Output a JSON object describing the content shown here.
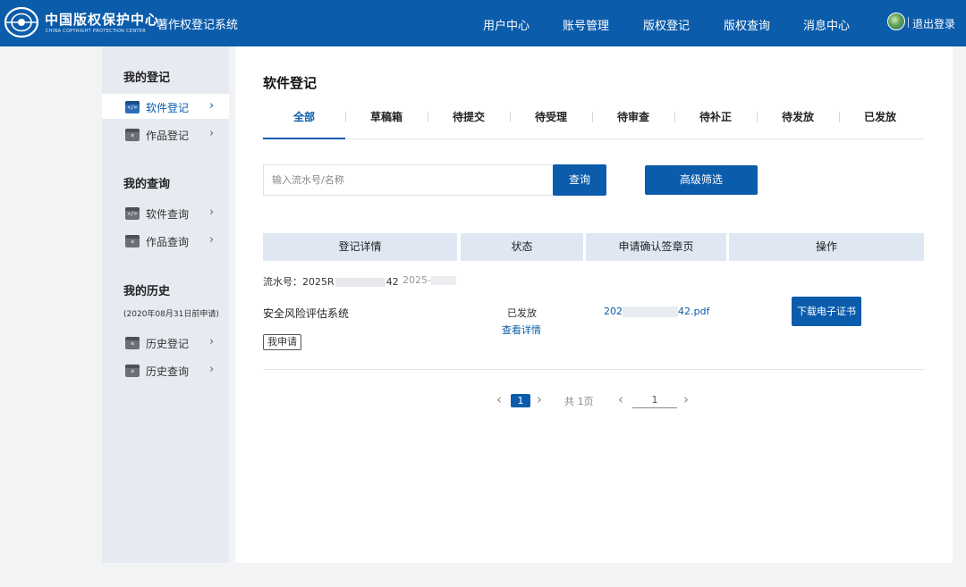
{
  "header": {
    "org_name_cn": "中国版权保护中心",
    "org_name_en": "CHINA COPYRIGHT PROTECTION CENTER",
    "system_name": "著作权登记系统",
    "nav": [
      "用户中心",
      "账号管理",
      "版权登记",
      "版权查询",
      "消息中心"
    ],
    "logout_label": "退出登录",
    "brand_color": "#0b5cab"
  },
  "sidebar": {
    "section_registration": "我的登记",
    "item_software_reg": "软件登记",
    "item_works_reg": "作品登记",
    "section_query": "我的查询",
    "item_software_query": "软件查询",
    "item_works_query": "作品查询",
    "section_history": "我的历史",
    "history_note": "(2020年08月31日前申请)",
    "item_history_reg": "历史登记",
    "item_history_query": "历史查询"
  },
  "main": {
    "page_title": "软件登记",
    "tabs": [
      "全部",
      "草稿箱",
      "待提交",
      "待受理",
      "待审查",
      "待补正",
      "待发放",
      "已发放"
    ],
    "search_placeholder": "输入流水号/名称",
    "search_button": "查询",
    "advanced_button": "高级筛选",
    "table_headers": [
      "登记详情",
      "状态",
      "申请确认签章页",
      "操作"
    ],
    "record": {
      "serial_label": "流水号：",
      "serial_prefix": "2025R",
      "serial_suffix": "42",
      "date_prefix": "2025-",
      "name": "安全风险评估系统",
      "tag": "我申请",
      "status": "已发放",
      "detail_link": "查看详情",
      "pdf_prefix": "202",
      "pdf_suffix": "42.pdf",
      "download_button": "下载电子证书"
    },
    "pager": {
      "current_page": "1",
      "total_text": "共 1页",
      "jump_value": "1"
    }
  }
}
